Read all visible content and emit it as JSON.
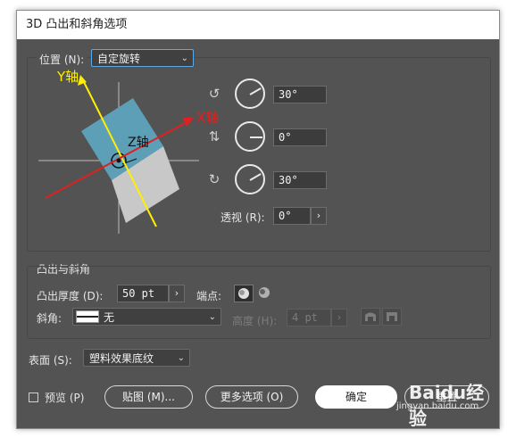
{
  "window": {
    "title": "3D 凸出和斜角选项"
  },
  "position": {
    "label": "位置 (N):",
    "preset": "自定旋转",
    "preview_labels": {
      "y_axis": "Y轴",
      "x_axis": "X轴",
      "z_axis": "Z轴"
    },
    "rotations": [
      {
        "icon": "rotate-x-axis-icon",
        "value": "30°",
        "angle": 30
      },
      {
        "icon": "rotate-y-axis-icon",
        "value": "0°",
        "angle": 0
      },
      {
        "icon": "rotate-z-axis-icon",
        "value": "30°",
        "angle": 30
      }
    ],
    "perspective_label": "透视 (R):",
    "perspective_value": "0°"
  },
  "extrude": {
    "section_label": "凸出与斜角",
    "depth_label": "凸出厚度 (D):",
    "depth_value": "50 pt",
    "cap_label": "端点:",
    "bevel_label": "斜角:",
    "bevel_value": "无",
    "height_label": "高度 (H):",
    "height_value": "4 pt"
  },
  "surface": {
    "label": "表面 (S):",
    "value": "塑料效果底纹"
  },
  "footer": {
    "preview_label": "预览 (P)",
    "map_button": "贴图 (M)...",
    "more_options_button": "更多选项 (O)",
    "ok_button": "确定",
    "reset_button": "重置"
  },
  "watermark": {
    "brand": "Baidu经验",
    "url": "jingyan.baidu.com"
  },
  "colors": {
    "dialog_bg": "#535353",
    "accent": "#5da9e6",
    "cube_front": "#5c9fb6",
    "cube_side": "#c8c8c8",
    "y_axis": "#ffef00",
    "x_axis": "#e02020"
  }
}
